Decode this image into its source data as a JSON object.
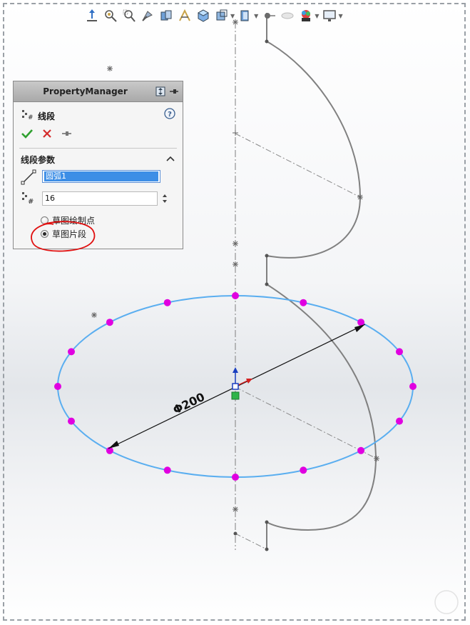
{
  "property_manager": {
    "title": "PropertyManager",
    "feature_name": "线段",
    "group_title": "线段参数",
    "selected_entity": "圆弧1",
    "segment_count": "16",
    "options": [
      {
        "label": "草图绘制点",
        "selected": false
      },
      {
        "label": "草图片段",
        "selected": true
      }
    ]
  },
  "dimension": {
    "label": "Φ200"
  },
  "toolbar": {
    "icons": [
      "view-orientation-icon",
      "zoom-to-fit-icon",
      "zoom-to-area-icon",
      "previous-view-icon",
      "section-view-icon",
      "dynamic-annotation-icon",
      "view-cube-icon",
      "display-style-icon",
      "hide-show-items-icon",
      "edit-appearance-icon",
      "apply-scene-icon",
      "view-settings-icon"
    ]
  },
  "colors": {
    "circle": "#5aaef0",
    "points": "#e000e0",
    "profile": "#808080",
    "centerline": "#7f7f7f",
    "accept": "#2fa02f",
    "cancel": "#d42b2b",
    "annotation": "#e01010"
  }
}
